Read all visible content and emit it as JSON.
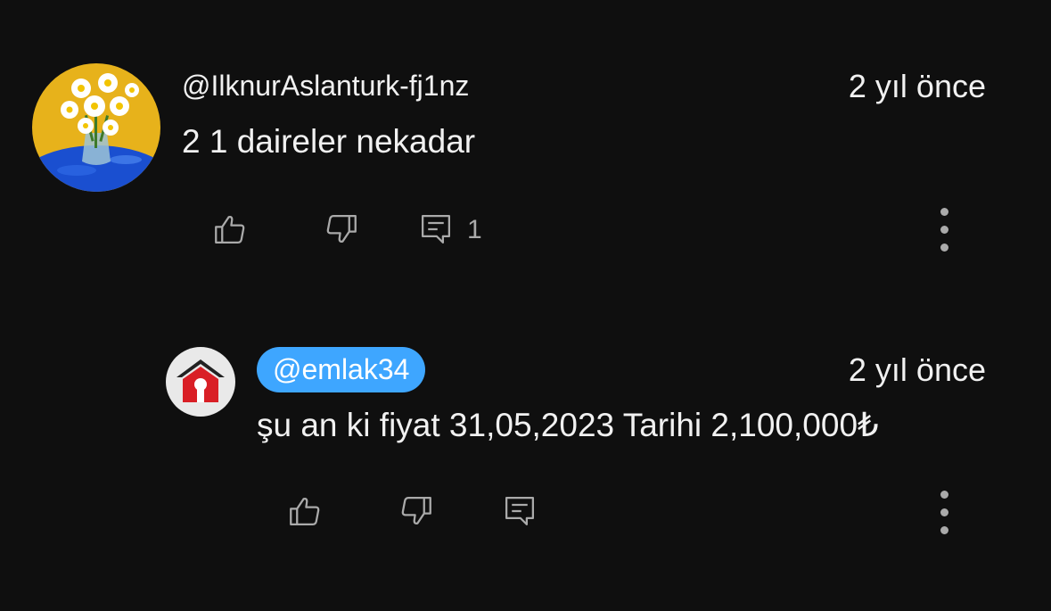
{
  "comments": [
    {
      "author": "@IlknurAslanturk-fj1nz",
      "time": "2 yıl önce",
      "text": "2 1 daireler nekadar",
      "reply_count": "1",
      "avatar_icon": "daisy-vase-painting-avatar"
    },
    {
      "author": "@emlak34",
      "author_highlighted": true,
      "time": "2 yıl önce",
      "text": "şu an ki fiyat 31,05,2023 Tarihi 2,100,000₺",
      "avatar_icon": "house-logo-avatar"
    }
  ],
  "icons": {
    "like": "thumbs-up-icon",
    "dislike": "thumbs-down-icon",
    "reply": "comment-reply-icon",
    "more": "more-vertical-icon"
  },
  "colors": {
    "background": "#0f0f0f",
    "text": "#f1f1f1",
    "icon": "#aaaaaa",
    "author_chip": "#3ea6ff"
  }
}
